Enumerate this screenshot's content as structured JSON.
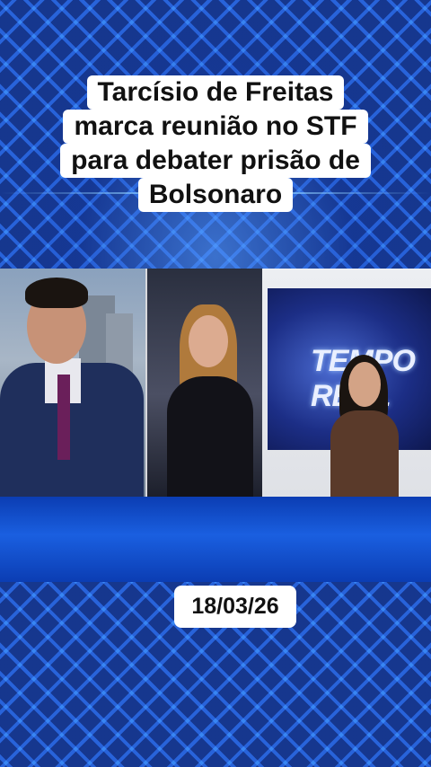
{
  "headline": {
    "lines": [
      "Tarcísio de Freitas",
      "marca reunião no STF",
      "para debater prisão de",
      "Bolsonaro"
    ]
  },
  "date": "18/03/26",
  "screen_logo": "TEMPO REAL",
  "colors": {
    "background": "#0a1f5c",
    "pattern": "#1e4fc8",
    "band": "#1a5fe0",
    "label_bg": "#ffffff",
    "label_text": "#111111"
  }
}
